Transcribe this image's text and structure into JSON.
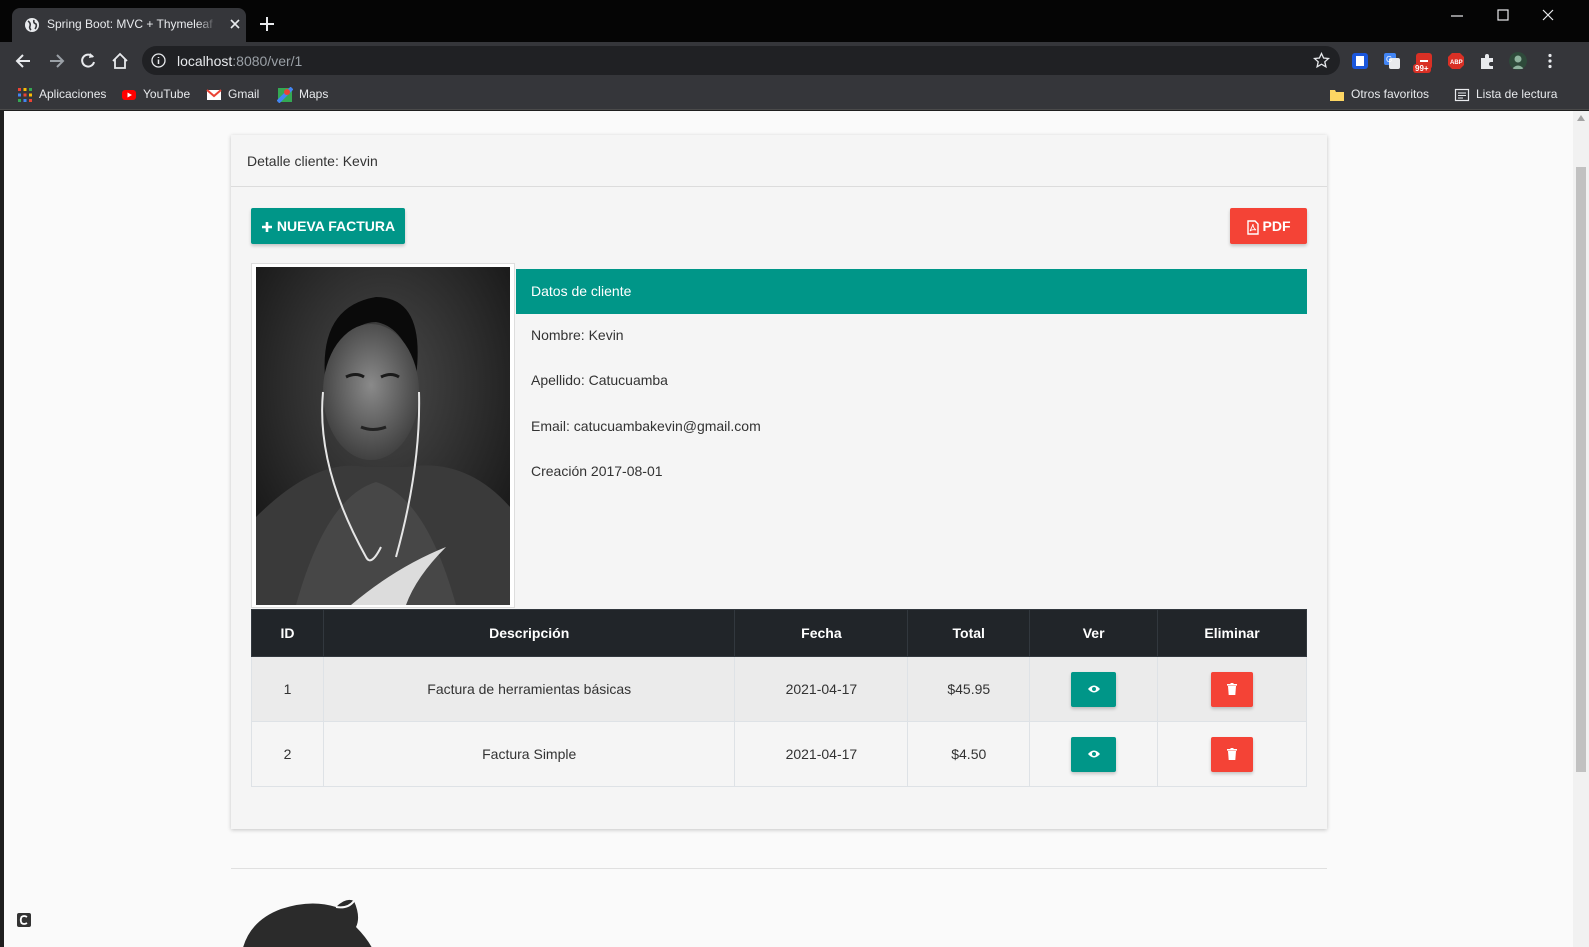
{
  "browser": {
    "tab_title": "Spring Boot: MVC + Thymeleaf + Data JPA",
    "url_host": "localhost",
    "url_path": ":8080/ver/1",
    "extension_badge": "99+",
    "bookmarks": [
      {
        "label": "Aplicaciones",
        "icon": "apps-grid-icon"
      },
      {
        "label": "YouTube",
        "icon": "youtube-icon"
      },
      {
        "label": "Gmail",
        "icon": "gmail-icon"
      },
      {
        "label": "Maps",
        "icon": "maps-icon"
      }
    ],
    "other_bookmarks": "Otros favoritos",
    "reading_list": "Lista de lectura"
  },
  "card": {
    "header": "Detalle cliente: Kevin",
    "new_invoice_label": "NUEVA FACTURA",
    "pdf_label": "PDF"
  },
  "client": {
    "section_title": "Datos de cliente",
    "name": "Nombre: Kevin",
    "surname": "Apellido: Catucuamba",
    "email": "Email: catucuambakevin@gmail.com",
    "created": "Creación 2017-08-01"
  },
  "invoices": {
    "headers": [
      "ID",
      "Descripción",
      "Fecha",
      "Total",
      "Ver",
      "Eliminar"
    ],
    "rows": [
      {
        "id": "1",
        "description": "Factura de herramientas básicas",
        "date": "2021-04-17",
        "total": "$45.95"
      },
      {
        "id": "2",
        "description": "Factura Simple",
        "date": "2021-04-17",
        "total": "$4.50"
      }
    ]
  },
  "colors": {
    "accent": "#009688",
    "danger": "#f44336",
    "table_header": "#212529"
  }
}
